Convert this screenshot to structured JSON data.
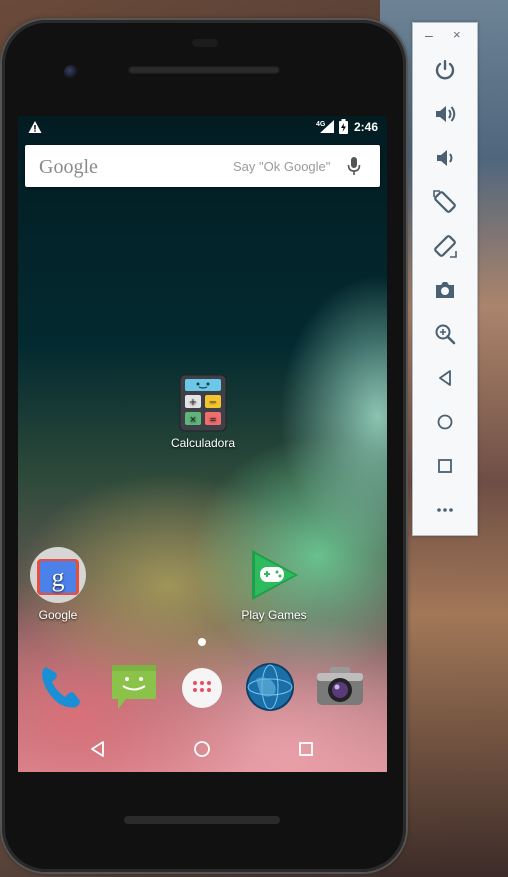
{
  "status_bar": {
    "network": "4G",
    "time": "2:46"
  },
  "search": {
    "logo": "Google",
    "hint": "Say \"Ok Google\""
  },
  "apps": {
    "calculator": "Calculadora",
    "google": "Google",
    "play_games": "Play Games"
  },
  "dock": [
    "phone-icon",
    "messages-icon",
    "app-drawer-icon",
    "browser-icon",
    "camera-icon"
  ],
  "nav": [
    "back-icon",
    "home-icon",
    "recents-icon"
  ],
  "emulator_panel": {
    "minimize": "–",
    "close": "×",
    "buttons": [
      "power-icon",
      "volume-up-icon",
      "volume-down-icon",
      "rotate-left-icon",
      "rotate-right-icon",
      "screenshot-icon",
      "zoom-icon",
      "back-icon",
      "home-icon",
      "overview-icon",
      "more-icon"
    ]
  },
  "colors": {
    "accent": "#4b6070",
    "wallpaper_top": "#021c22",
    "play_green": "#2dbb5d"
  }
}
